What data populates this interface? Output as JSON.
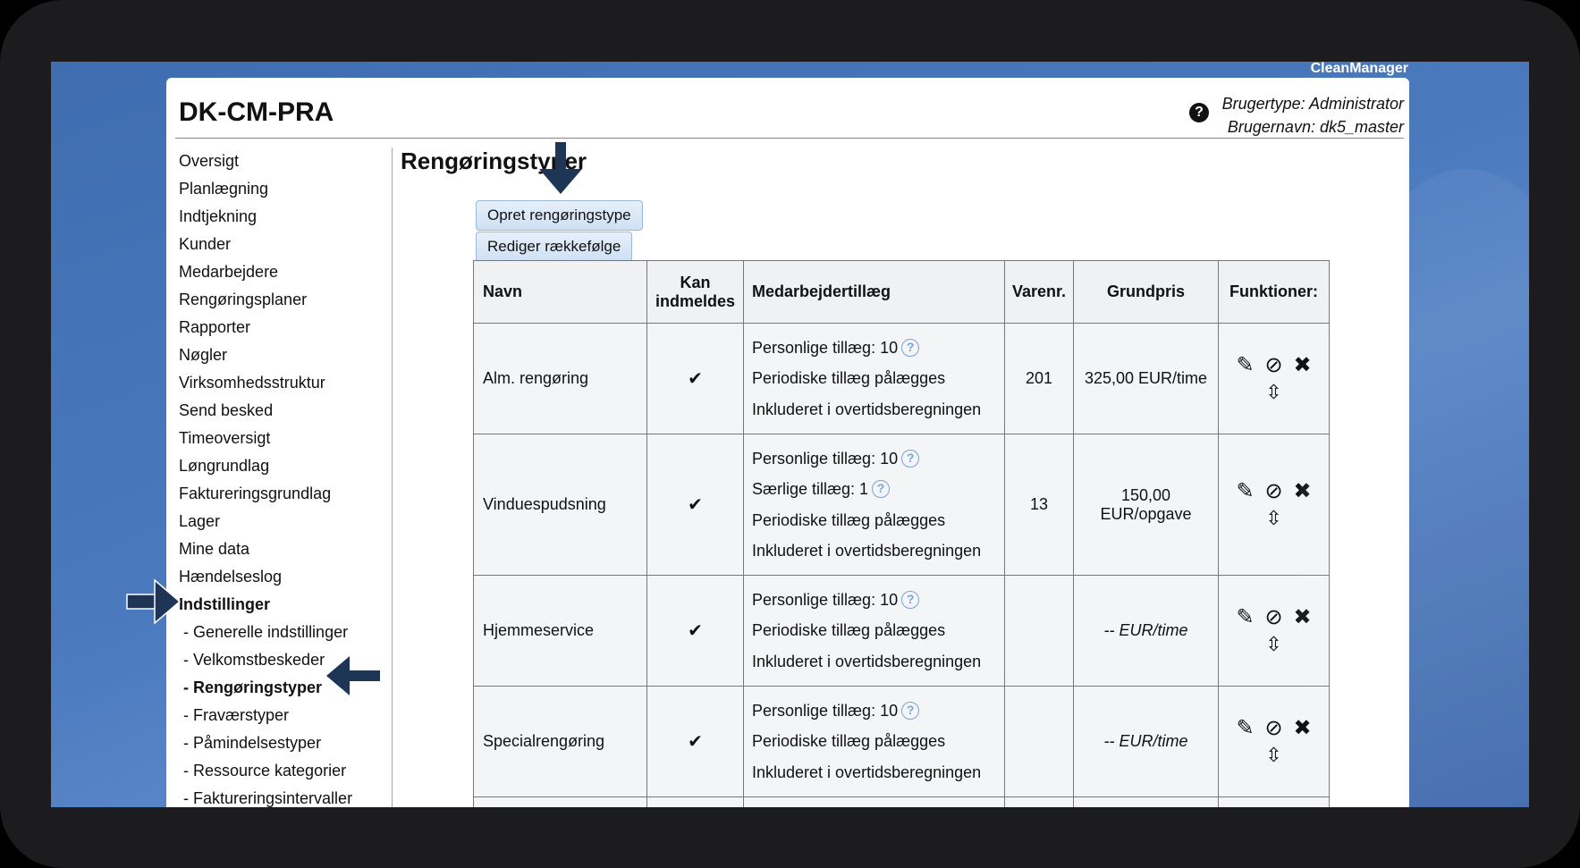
{
  "brand": "CleanManager",
  "app_title": "DK-CM-PRA",
  "user": {
    "type_line": "Brugertype: Administrator",
    "name_line": "Brugernavn: dk5_master"
  },
  "sidebar": {
    "items": [
      {
        "label": "Oversigt"
      },
      {
        "label": "Planlægning"
      },
      {
        "label": "Indtjekning"
      },
      {
        "label": "Kunder"
      },
      {
        "label": "Medarbejdere"
      },
      {
        "label": "Rengøringsplaner"
      },
      {
        "label": "Rapporter"
      },
      {
        "label": "Nøgler"
      },
      {
        "label": "Virksomhedsstruktur"
      },
      {
        "label": "Send besked"
      },
      {
        "label": "Timeoversigt"
      },
      {
        "label": "Løngrundlag"
      },
      {
        "label": "Faktureringsgrundlag"
      },
      {
        "label": "Lager"
      },
      {
        "label": "Mine data"
      },
      {
        "label": "Hændelseslog"
      },
      {
        "label": "Indstillinger"
      }
    ],
    "subitems": [
      {
        "label": "- Generelle indstillinger"
      },
      {
        "label": "- Velkomstbeskeder"
      },
      {
        "label": "- Rengøringstyper"
      },
      {
        "label": "- Fraværstyper"
      },
      {
        "label": "- Påmindelsestyper"
      },
      {
        "label": "- Ressource kategorier"
      },
      {
        "label": "- Faktureringsintervaller"
      }
    ]
  },
  "page_title": "Rengøringstyper",
  "buttons": {
    "create": "Opret rengøringstype",
    "reorder": "Rediger rækkefølge"
  },
  "table": {
    "headers": {
      "name": "Navn",
      "kan_line1": "Kan",
      "kan_line2": "indmeldes",
      "med": "Medarbejdertillæg",
      "varenr": "Varenr.",
      "grundpris": "Grundpris",
      "funktioner": "Funktioner:"
    },
    "rows": [
      {
        "name": "Alm. rengøring",
        "check": "✔",
        "med": [
          "Personlige tillæg: 10",
          "Periodiske tillæg pålægges",
          "Inkluderet i overtidsberegningen"
        ],
        "varenr": "201",
        "grundpris_1": "325,00 EUR/time",
        "grundpris_2": ""
      },
      {
        "name": "Vinduespudsning",
        "check": "✔",
        "med": [
          "Personlige tillæg: 10",
          "Særlige tillæg: 1",
          "Periodiske tillæg pålægges",
          "Inkluderet i overtidsberegningen"
        ],
        "varenr": "13",
        "grundpris_1": "150,00",
        "grundpris_2": "EUR/opgave"
      },
      {
        "name": "Hjemmeservice",
        "check": "✔",
        "med": [
          "Personlige tillæg: 10",
          "Periodiske tillæg pålægges",
          "Inkluderet i overtidsberegningen"
        ],
        "varenr": "",
        "grundpris_1": "-- EUR/time",
        "grundpris_2": ""
      },
      {
        "name": "Specialrengøring",
        "check": "✔",
        "med": [
          "Personlige tillæg: 10",
          "Periodiske tillæg pålægges",
          "Inkluderet i overtidsberegningen"
        ],
        "varenr": "",
        "grundpris_1": "-- EUR/time",
        "grundpris_2": ""
      }
    ]
  },
  "icons": {
    "help": "?",
    "info": "?",
    "edit": "✎",
    "hide": "⊘",
    "delete": "✖",
    "move": "⇳"
  },
  "colors": {
    "arrow": "#1e3556",
    "button_bg": "#d6e5f6",
    "desktop": "#4a79be"
  }
}
